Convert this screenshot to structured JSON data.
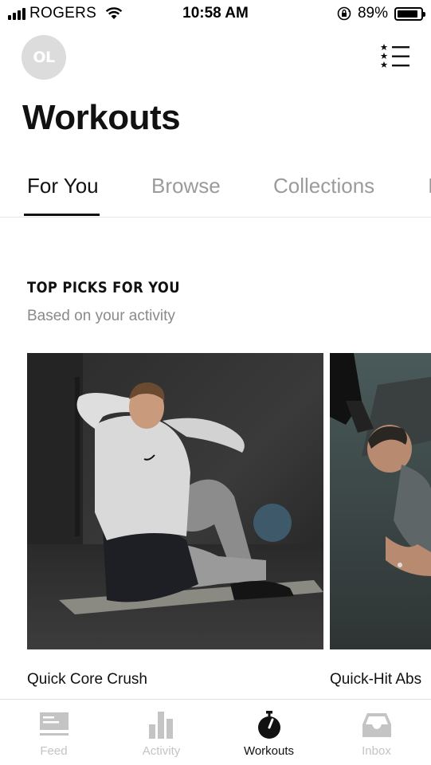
{
  "status_bar": {
    "carrier": "ROGERS",
    "time": "10:58 AM",
    "battery": "89%",
    "battery_level": 0.89
  },
  "header": {
    "avatar_initials": "OL",
    "title": "Workouts",
    "menu_icon": "starred-list-icon"
  },
  "tabs": [
    {
      "label": "For You",
      "active": true
    },
    {
      "label": "Browse",
      "active": false
    },
    {
      "label": "Collections",
      "active": false
    },
    {
      "label": "I",
      "active": false
    }
  ],
  "section": {
    "title": "TOP PICKS FOR YOU",
    "subtitle": "Based on your activity"
  },
  "cards": [
    {
      "title": "Quick Core Crush"
    },
    {
      "title": "Quick-Hit Abs"
    }
  ],
  "tabbar": [
    {
      "label": "Feed",
      "icon": "feed-icon",
      "active": false
    },
    {
      "label": "Activity",
      "icon": "activity-bars-icon",
      "active": false
    },
    {
      "label": "Workouts",
      "icon": "stopwatch-icon",
      "active": true
    },
    {
      "label": "Inbox",
      "icon": "inbox-tray-icon",
      "active": false
    }
  ],
  "colors": {
    "active": "#111111",
    "inactive": "#9b9b9b",
    "tabbar_inactive": "#c4c4c4",
    "avatar_bg": "#dcdcdc"
  }
}
